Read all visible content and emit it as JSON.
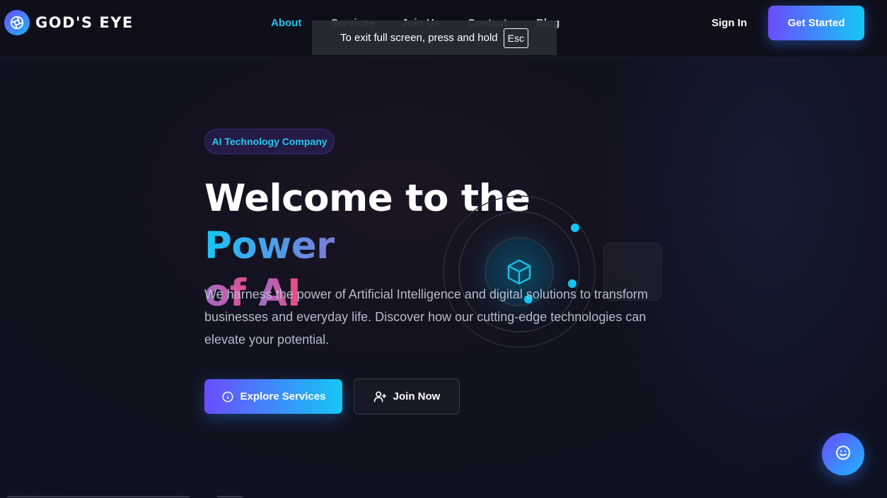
{
  "brand": {
    "name": "GOD'S EYE",
    "logo_icon": "eye-aperture-icon"
  },
  "nav": {
    "items": [
      {
        "label": "About",
        "active": true
      },
      {
        "label": "Services",
        "active": false
      },
      {
        "label": "Join Us",
        "active": false
      },
      {
        "label": "Contact",
        "active": false
      },
      {
        "label": "Blog",
        "active": false
      }
    ]
  },
  "header": {
    "signin_label": "Sign In",
    "cta_label": "Get Started"
  },
  "fullscreen_notice": {
    "text": "To exit full screen, press and hold",
    "key": "Esc"
  },
  "hero": {
    "badge": "AI Technology Company",
    "title_part1": "Welcome to the ",
    "title_highlight1": "Power",
    "title_highlight2a": "of ",
    "title_highlight2b": "AI",
    "description": "We harness the power of Artificial Intelligence and digital solutions to transform businesses and everyday life. Discover how our cutting-edge technologies can elevate your potential.",
    "primary_button": {
      "label": "Explore Services",
      "icon": "info-circle-icon"
    },
    "secondary_button": {
      "label": "Join Now",
      "icon": "user-plus-icon"
    }
  },
  "chat": {
    "icon": "smiley-face-icon"
  },
  "colors": {
    "accent_cyan": "#22c3e6",
    "accent_purple": "#6a4cff",
    "accent_pink": "#ee4a7e",
    "background": "#11121f"
  }
}
